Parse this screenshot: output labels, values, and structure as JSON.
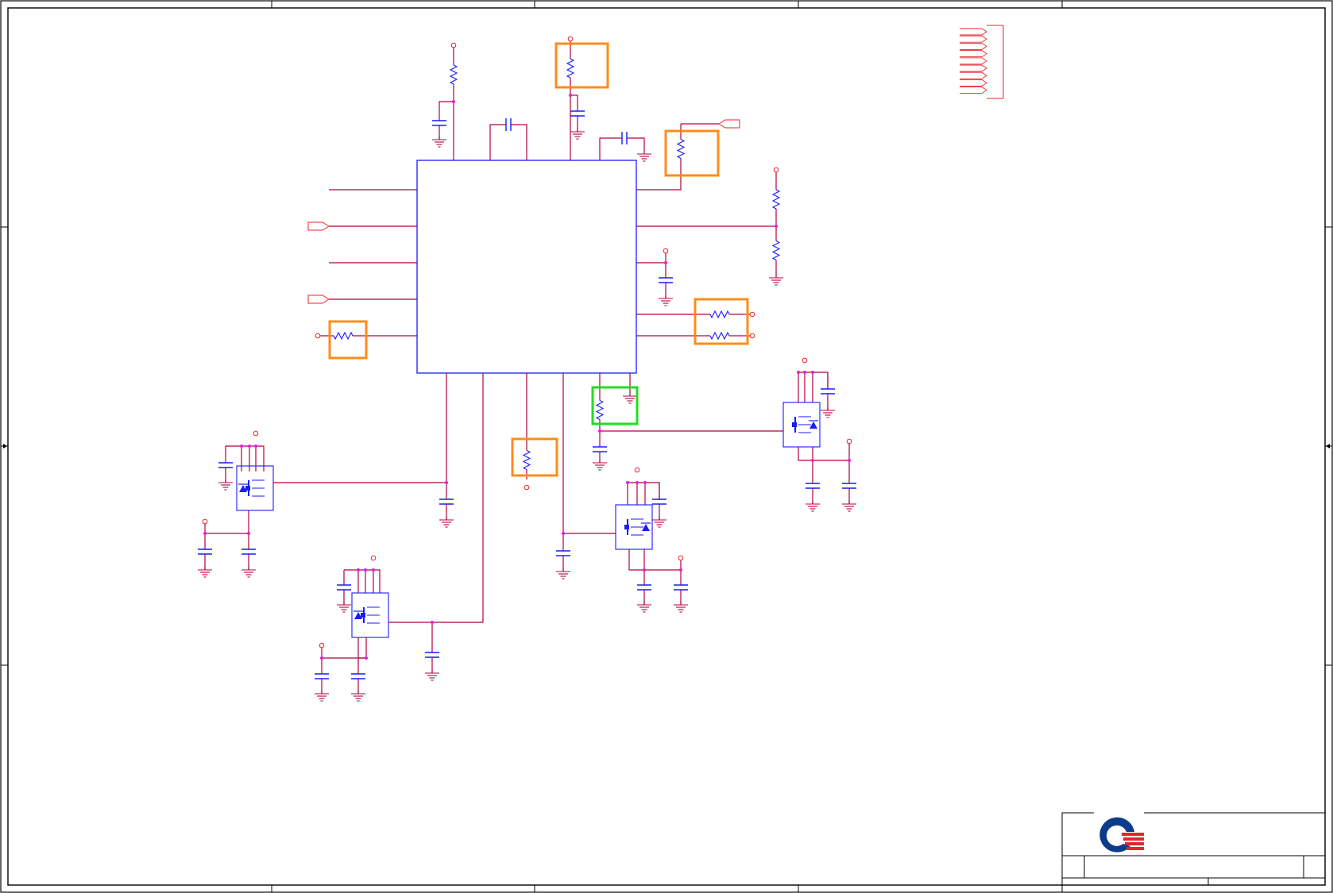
{
  "sheet": {
    "background": "#ffffff",
    "wire_color": "#b3003c",
    "component_color": "#1a1aff",
    "net_flag_color": "#e8262c",
    "junction_color": "#e01ee0",
    "highlight_orange": "#ff8c1a",
    "highlight_green": "#22dd22",
    "border_color": "#000000"
  },
  "title_block": {
    "logo": {
      "name": "company-logo",
      "ring_color": "#0d3c8c",
      "stripe_color": "#e3262b"
    }
  },
  "components": {
    "main_ic": "integrated-circuit",
    "resistor_count": 10,
    "capacitor_count": 22,
    "mosfet_count": 4,
    "ground_count": 24
  },
  "highlights": [
    {
      "color": "orange",
      "label": ""
    },
    {
      "color": "orange",
      "label": ""
    },
    {
      "color": "orange",
      "label": ""
    },
    {
      "color": "orange",
      "label": ""
    },
    {
      "color": "orange",
      "label": ""
    },
    {
      "color": "green",
      "label": ""
    }
  ]
}
